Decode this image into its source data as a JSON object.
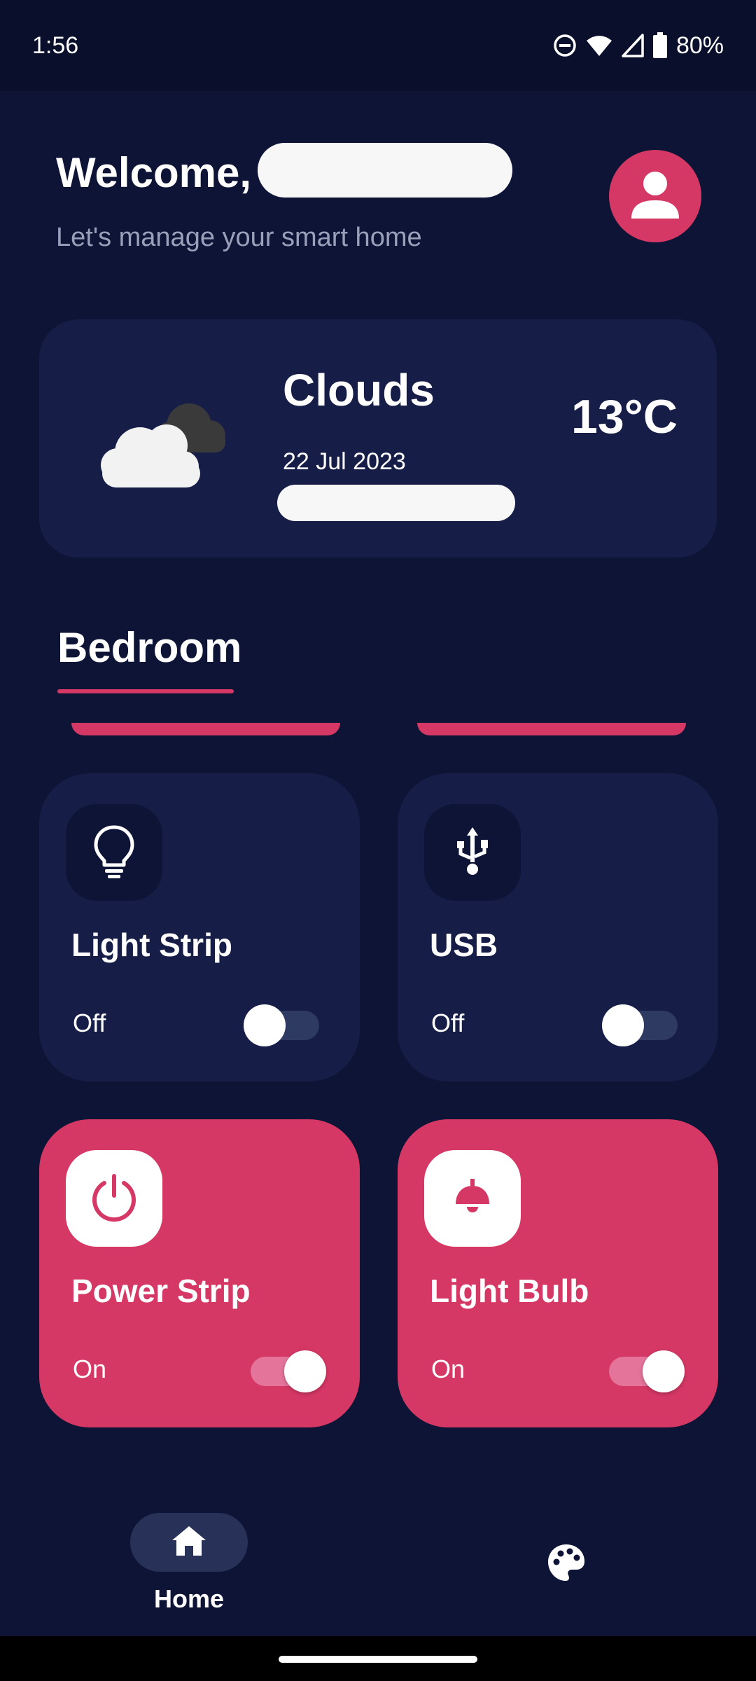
{
  "status_bar": {
    "time": "1:56",
    "battery": "80%",
    "icons": [
      "do-not-disturb-icon",
      "wifi-icon",
      "cellular-signal-icon",
      "battery-icon"
    ]
  },
  "header": {
    "welcome": "Welcome,",
    "subtitle": "Let's manage your smart home",
    "avatar_icon": "person-icon"
  },
  "weather": {
    "condition": "Clouds",
    "date": "22 Jul 2023",
    "temperature": "13°C",
    "icon": "cloudy-icon"
  },
  "room_tab": {
    "label": "Bedroom"
  },
  "devices": [
    {
      "name": "Light Strip",
      "state": "Off",
      "on": false,
      "icon": "lightbulb-outline-icon"
    },
    {
      "name": "USB",
      "state": "Off",
      "on": false,
      "icon": "usb-icon"
    },
    {
      "name": "Power Strip",
      "state": "On",
      "on": true,
      "icon": "power-icon"
    },
    {
      "name": "Light Bulb",
      "state": "On",
      "on": true,
      "icon": "ceiling-lamp-icon"
    }
  ],
  "bottom_nav": {
    "home_label": "Home",
    "home_icon": "home-icon",
    "palette_icon": "palette-icon"
  },
  "colors": {
    "background": "#0d1436",
    "card": "#161e47",
    "accent": "#d63865",
    "status_bar": "#0a102c"
  }
}
